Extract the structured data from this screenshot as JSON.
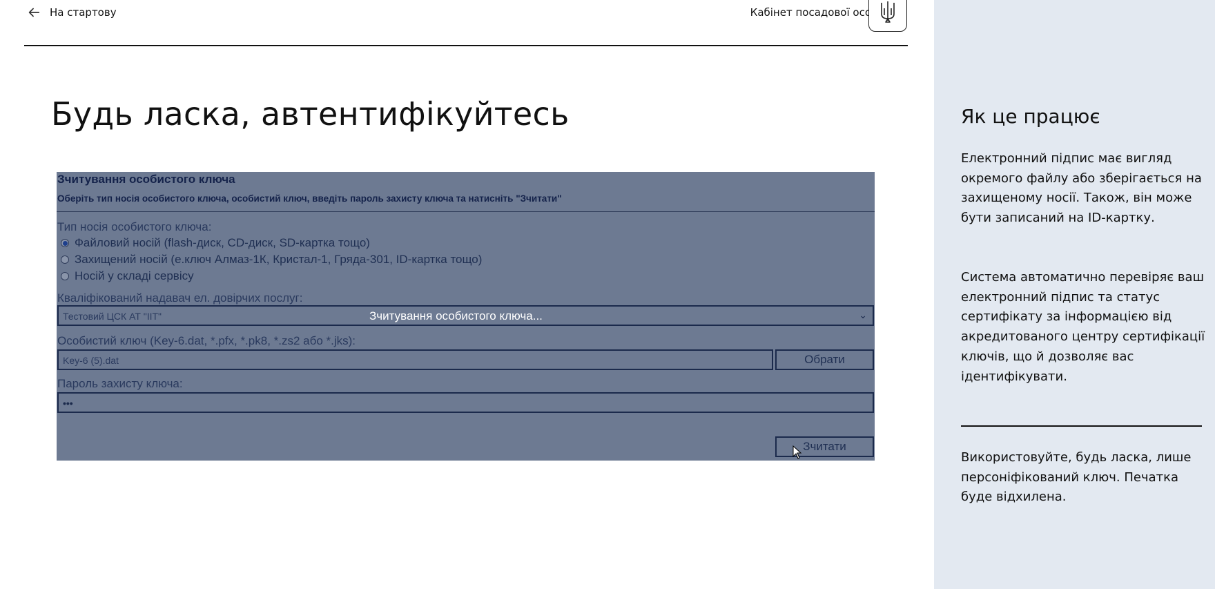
{
  "header": {
    "back_label": "На стартову",
    "cabinet_label": "Кабінет посадової особи"
  },
  "page": {
    "title": "Будь ласка, автентифікуйтесь"
  },
  "key_form": {
    "title": "Зчитування особистого ключа",
    "subtitle": "Оберіть тип носія особистого ключа, особистий ключ, введіть пароль захисту ключа та натисніть \"Зчитати\"",
    "media_type_label": "Тип носія особистого ключа:",
    "media_options": [
      {
        "label": "Файловий носій (flash-диск, CD-диск, SD-картка тощо)",
        "checked": true
      },
      {
        "label": "Захищений носій (е.ключ Алмаз-1К, Кристал-1, Гряда-301, ID-картка тощо)",
        "checked": false
      },
      {
        "label": "Носій у складі сервісу",
        "checked": false
      }
    ],
    "provider_label": "Кваліфікований надавач ел. довірчих послуг:",
    "provider_value": "Тестовий ЦСК АТ \"ІІТ\"",
    "loading_text": "Зчитування особистого ключа...",
    "key_label": "Особистий ключ (Key-6.dat, *.pfx, *.pk8, *.zs2 або *.jks):",
    "key_value": "Key-6 (5).dat",
    "choose_button": "Обрати",
    "password_label": "Пароль захисту ключа:",
    "password_value": "•••",
    "read_button": "Зчитати"
  },
  "sidebar": {
    "title": "Як це працює",
    "p1": "Електронний підпис має вигляд окремого файлу або зберігається на захищеному носії. Також, він може бути записаний на ID-картку.",
    "p2": "Система автоматично перевіряє ваш електронний підпис та статус сертифікату за інформацією від акредитованого центру сертифікації ключів, що й дозволяє вас ідентифікувати.",
    "p3": "Використовуйте, будь ласка, лише персоніфікований ключ. Печатка буде відхилена."
  },
  "colors": {
    "sidebar_bg": "#e3e9f1",
    "panel_overlay": "#6d7a92",
    "panel_border": "#1b2a4c"
  }
}
